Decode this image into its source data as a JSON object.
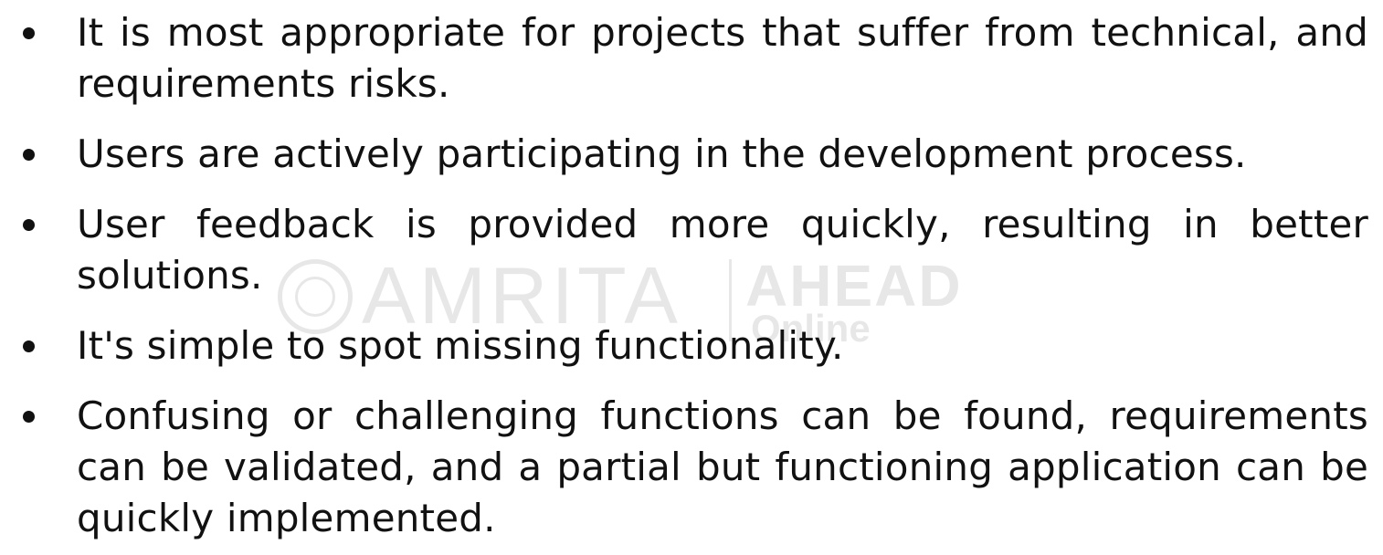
{
  "watermark": {
    "brand": "AMRITA",
    "product": "AHEAD",
    "sub": "Online"
  },
  "bullets": [
    {
      "text": "It is most appropriate for projects that suffer from technical, and requirements risks."
    },
    {
      "text": "Users are actively participating in the development process."
    },
    {
      "text": "User feedback is provided more quickly, resulting in better solutions."
    },
    {
      "text": "It's simple to spot missing functionality."
    },
    {
      "text": "Confusing or challenging functions can be found, requirements can be validated, and a partial but functioning application can be quickly implemented."
    }
  ]
}
